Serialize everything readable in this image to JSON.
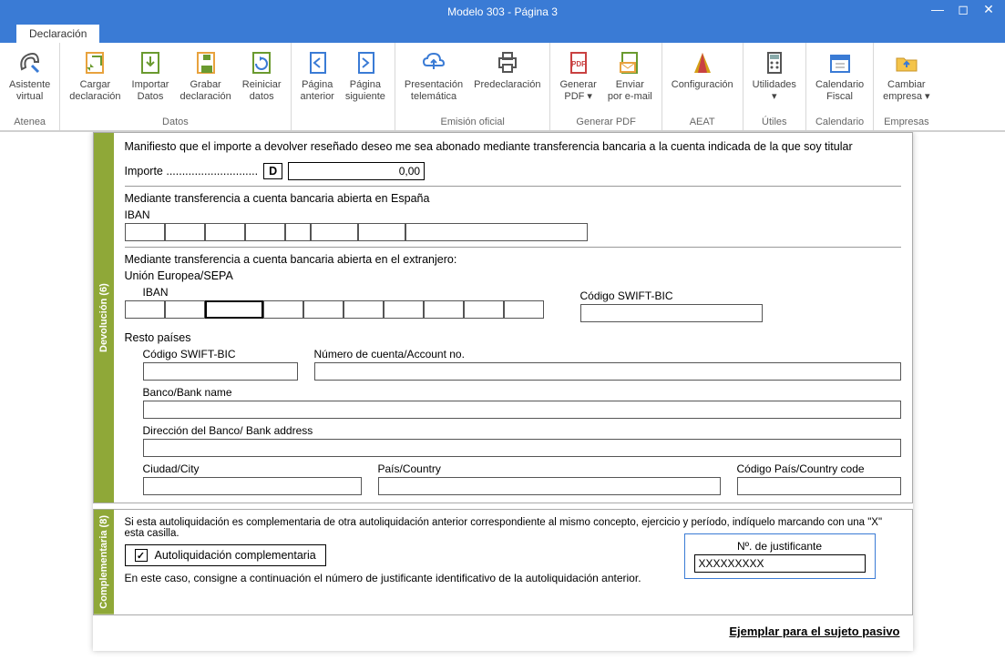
{
  "window": {
    "title": "Modelo 303 - Página 3"
  },
  "tab": {
    "label": "Declaración"
  },
  "ribbon": {
    "atenea": {
      "asistente": "Asistente\nvirtual",
      "group": "Atenea"
    },
    "datos": {
      "cargar": "Cargar\ndeclaración",
      "importar": "Importar\nDatos",
      "grabar": "Grabar\ndeclaración",
      "reiniciar": "Reiniciar\ndatos",
      "group": "Datos"
    },
    "nav": {
      "anterior": "Página\nanterior",
      "siguiente": "Página\nsiguiente"
    },
    "emision": {
      "presentacion": "Presentación\ntelemática",
      "predeclaracion": "Predeclaración",
      "group": "Emisión oficial"
    },
    "pdf": {
      "generar": "Generar\nPDF ▾",
      "enviar": "Enviar\npor e-mail",
      "group": "Generar PDF"
    },
    "aeat": {
      "config": "Configuración",
      "group": "AEAT"
    },
    "utiles": {
      "util": "Utilidades\n▾",
      "group": "Útiles"
    },
    "calendario": {
      "cal": "Calendario\nFiscal",
      "group": "Calendario"
    },
    "empresas": {
      "cambiar": "Cambiar\nempresa ▾",
      "group": "Empresas"
    }
  },
  "form": {
    "dev_tab": "Devolución (6)",
    "comp_tab": "Complementaria (8)",
    "declare": "Manifiesto que el importe a devolver reseñado deseo me sea abonado mediante transferencia bancaria a la cuenta indicada de la que soy titular",
    "importe_label": "Importe .............................",
    "importe_d": "D",
    "importe_val": "0,00",
    "spain_hdr": "Mediante transferencia a cuenta bancaria abierta en España",
    "iban_lbl": "IBAN",
    "foreign_hdr": "Mediante transferencia a cuenta bancaria abierta en el extranjero:",
    "ue_lbl": "Unión Europea/SEPA",
    "swift_lbl": "Código SWIFT-BIC",
    "resto_lbl": "Resto países",
    "account_lbl": "Número de cuenta/Account no.",
    "bank_lbl": "Banco/Bank name",
    "bankaddr_lbl": "Dirección del Banco/ Bank address",
    "city_lbl": "Ciudad/City",
    "country_lbl": "País/Country",
    "ccode_lbl": "Código País/Country code",
    "comp_text": "Si esta autoliquidación es complementaria de otra autoliquidación anterior correspondiente al mismo concepto, ejercicio y período, indíquelo marcando con una \"X\" esta casilla.",
    "comp_chk": "Autoliquidación complementaria",
    "comp_text2": "En este caso, consigne a continuación el número de justificante identificativo de la autoliquidación anterior.",
    "justif_lbl": "Nº. de justificante",
    "justif_val": "XXXXXXXXX",
    "footer": "Ejemplar para el sujeto pasivo"
  }
}
